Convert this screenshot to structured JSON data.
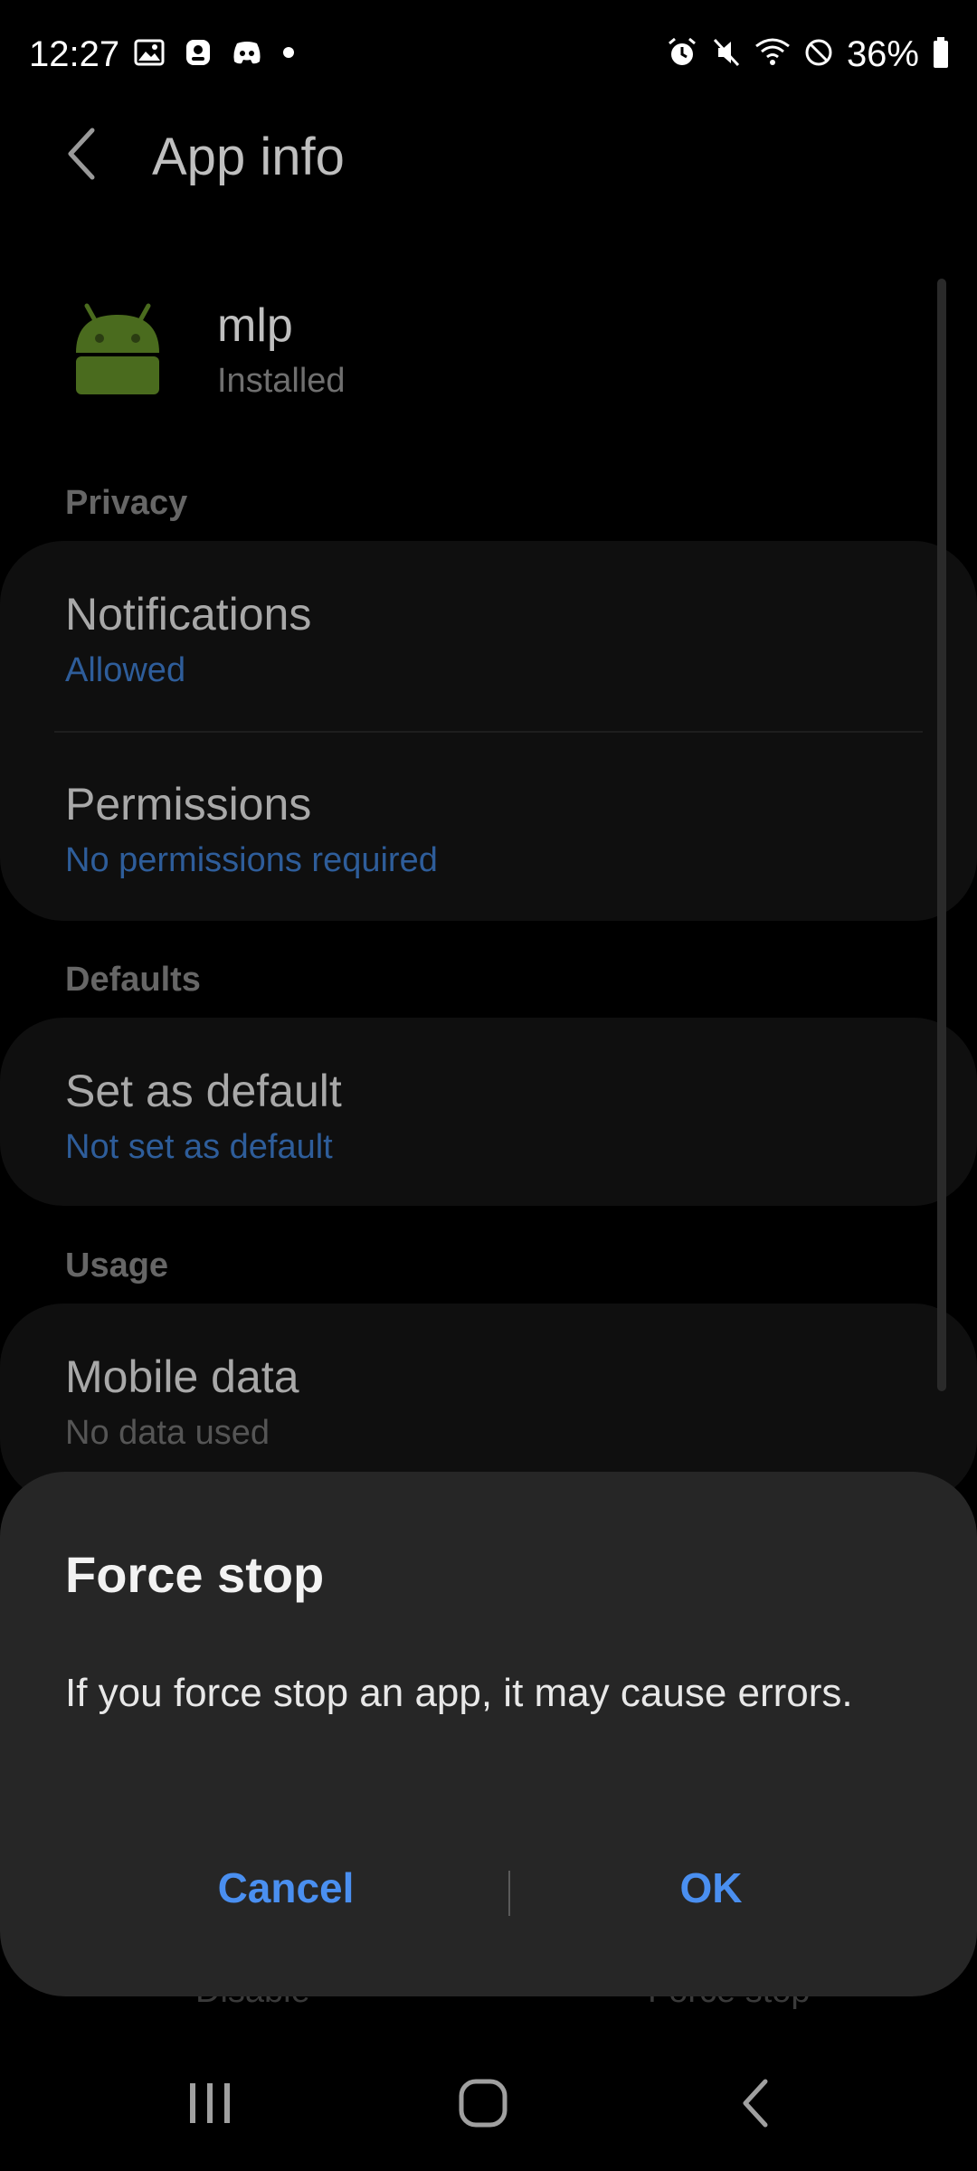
{
  "status_bar": {
    "time": "12:27",
    "battery": "36%",
    "left_icons": [
      "gallery-icon",
      "profile-icon",
      "discord-icon",
      "dot-icon"
    ],
    "right_icons": [
      "alarm-icon",
      "mute-icon",
      "wifi-icon",
      "dnd-icon",
      "battery-icon"
    ]
  },
  "app_bar": {
    "title": "App info",
    "back_icon": "chevron-left-icon"
  },
  "app": {
    "name": "mlp",
    "status": "Installed",
    "icon": "android-icon",
    "icon_color": "#4a6b1e"
  },
  "sections": {
    "privacy": {
      "label": "Privacy",
      "notifications_title": "Notifications",
      "notifications_value": "Allowed",
      "permissions_title": "Permissions",
      "permissions_value": "No permissions required"
    },
    "defaults": {
      "label": "Defaults",
      "set_default_title": "Set as default",
      "set_default_value": "Not set as default"
    },
    "usage": {
      "label": "Usage",
      "mobile_data_title": "Mobile data",
      "mobile_data_value": "No data used"
    }
  },
  "bottom_actions": {
    "disable": "Disable",
    "force_stop": "Force stop"
  },
  "dialog": {
    "title": "Force stop",
    "message": "If you force stop an app, it may cause errors.",
    "cancel": "Cancel",
    "ok": "OK",
    "accent": "#4a8ff0"
  },
  "nav_bar": {
    "recents": "recents-icon",
    "home": "home-icon",
    "back": "back-icon"
  }
}
